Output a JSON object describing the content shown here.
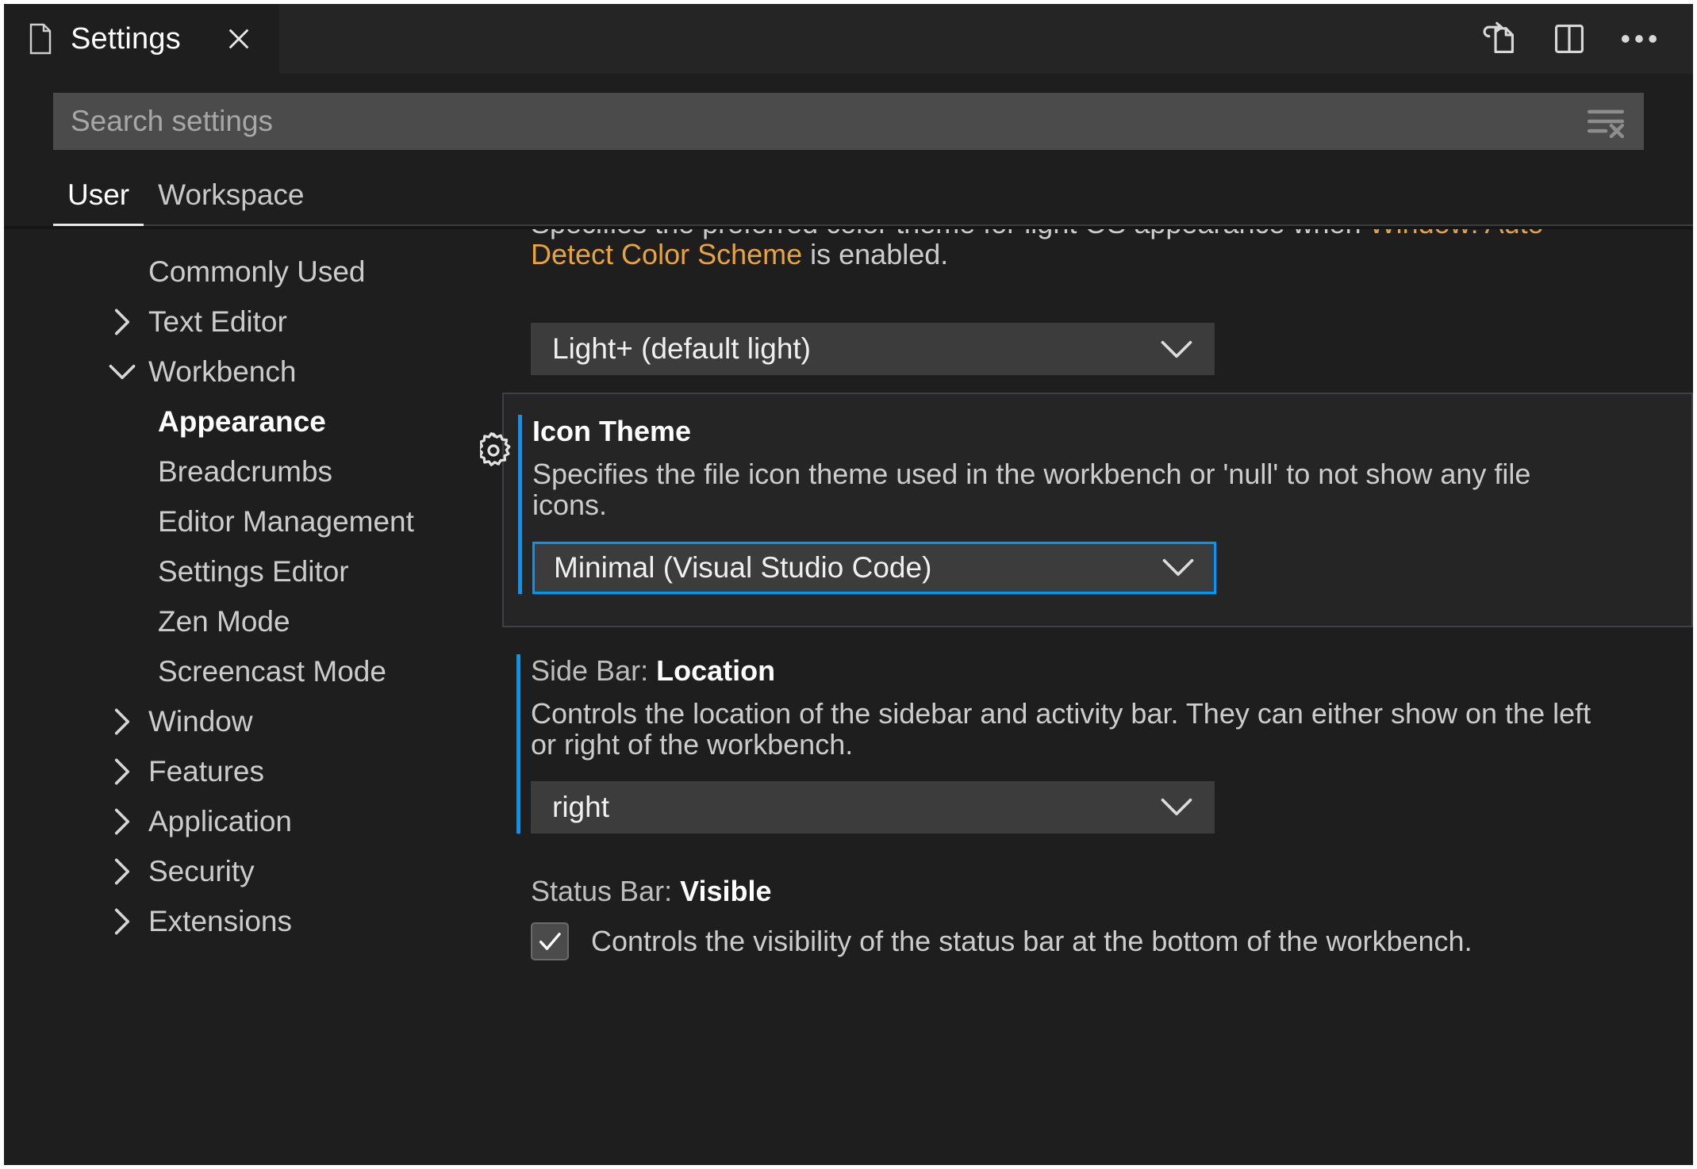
{
  "window": {
    "tab": {
      "label": "Settings",
      "icon": "file-icon",
      "close_icon": "close-icon"
    },
    "actions": [
      {
        "name": "open-settings-json-button",
        "icon": "open-file-external-icon"
      },
      {
        "name": "split-editor-button",
        "icon": "split-editor-icon"
      },
      {
        "name": "more-actions-button",
        "icon": "ellipsis-icon"
      }
    ]
  },
  "search": {
    "placeholder": "Search settings",
    "value": "",
    "clear_icon": "clear-filter-icon"
  },
  "scope_tabs": [
    {
      "label": "User",
      "active": true
    },
    {
      "label": "Workspace",
      "active": false
    }
  ],
  "toc": {
    "items": [
      {
        "label": "Commonly Used",
        "twisty": "none",
        "level": 0,
        "selected": false
      },
      {
        "label": "Text Editor",
        "twisty": "collapsed",
        "level": 0,
        "selected": false
      },
      {
        "label": "Workbench",
        "twisty": "expanded",
        "level": 0,
        "selected": false
      },
      {
        "label": "Appearance",
        "twisty": "none",
        "level": 1,
        "selected": true
      },
      {
        "label": "Breadcrumbs",
        "twisty": "none",
        "level": 1,
        "selected": false
      },
      {
        "label": "Editor Management",
        "twisty": "none",
        "level": 1,
        "selected": false
      },
      {
        "label": "Settings Editor",
        "twisty": "none",
        "level": 1,
        "selected": false
      },
      {
        "label": "Zen Mode",
        "twisty": "none",
        "level": 1,
        "selected": false
      },
      {
        "label": "Screencast Mode",
        "twisty": "none",
        "level": 1,
        "selected": false
      },
      {
        "label": "Window",
        "twisty": "collapsed",
        "level": 0,
        "selected": false
      },
      {
        "label": "Features",
        "twisty": "collapsed",
        "level": 0,
        "selected": false
      },
      {
        "label": "Application",
        "twisty": "collapsed",
        "level": 0,
        "selected": false
      },
      {
        "label": "Security",
        "twisty": "collapsed",
        "level": 0,
        "selected": false
      },
      {
        "label": "Extensions",
        "twisty": "collapsed",
        "level": 0,
        "selected": false
      }
    ]
  },
  "settings": {
    "preferred_light_theme": {
      "description_prefix": "Specifies the preferred color theme for light OS appearance when ",
      "description_link": "Window: Auto Detect Color Scheme",
      "description_suffix": " is enabled.",
      "value": "Light+ (default light)"
    },
    "icon_theme": {
      "title": "Icon Theme",
      "description": "Specifies the file icon theme used in the workbench or 'null' to not show any file icons.",
      "value": "Minimal (Visual Studio Code)",
      "gear_icon": "gear-icon"
    },
    "side_bar_location": {
      "category": "Side Bar: ",
      "key": "Location",
      "description": "Controls the location of the sidebar and activity bar. They can either show on the left or right of the workbench.",
      "value": "right"
    },
    "status_bar_visible": {
      "category": "Status Bar: ",
      "key": "Visible",
      "description": "Controls the visibility of the status bar at the bottom of the workbench.",
      "checked": true
    }
  },
  "colors": {
    "editor_background": "#1e1e1e",
    "tabbar_background": "#252526",
    "accent_blue": "#0097fb",
    "link_orange": "#e8a33d",
    "input_background": "#4b4b4b",
    "dropdown_background": "#3c3c3c"
  }
}
